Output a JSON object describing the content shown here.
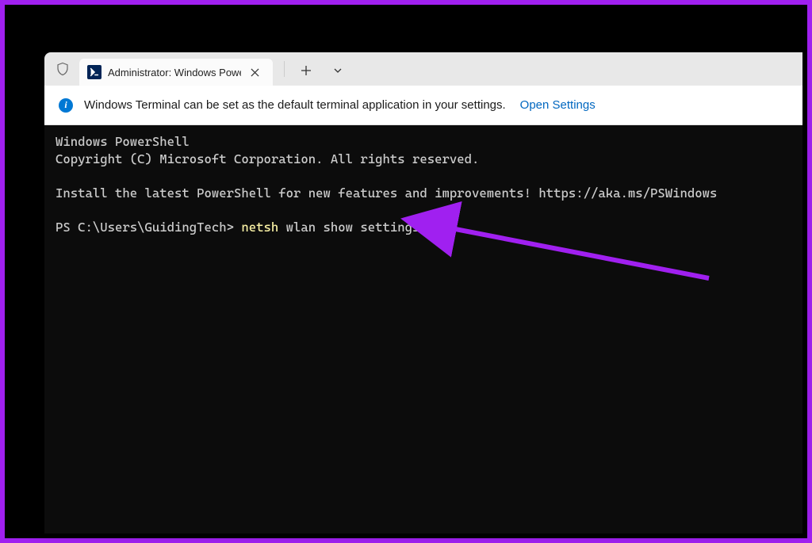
{
  "window": {
    "tab_title": "Administrator: Windows Powe",
    "tab_icon_text": ">_"
  },
  "infobar": {
    "message": "Windows Terminal can be set as the default terminal application in your settings.",
    "link": "Open Settings"
  },
  "terminal": {
    "line1": "Windows PowerShell",
    "line2": "Copyright (C) Microsoft Corporation. All rights reserved.",
    "line3": "Install the latest PowerShell for new features and improvements! https://aka.ms/PSWindows",
    "prompt": "PS C:\\Users\\GuidingTech> ",
    "command_first": "netsh",
    "command_rest": " wlan show settings"
  },
  "annotation": {
    "arrow_color": "#a020f0"
  }
}
